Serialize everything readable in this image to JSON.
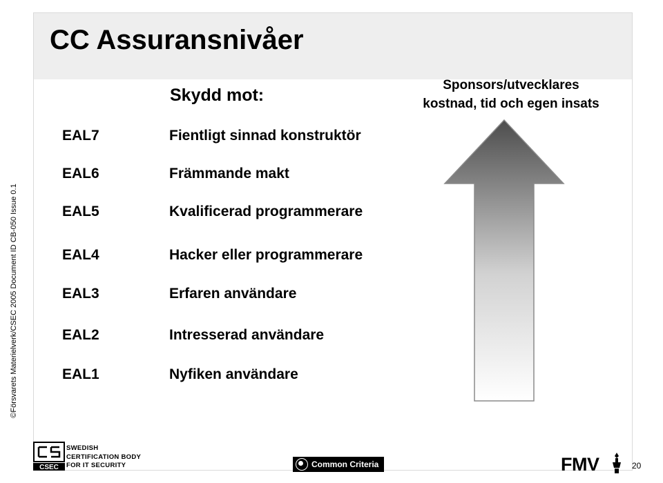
{
  "slide": {
    "title": "CC Assuransnivåer",
    "page_number": "20"
  },
  "headers": {
    "protection": "Skydd mot:",
    "sponsor_line1": "Sponsors/utvecklares",
    "sponsor_line2": "kostnad, tid och egen insats"
  },
  "levels": [
    {
      "eal": "EAL7",
      "threat": "Fientligt sinnad konstruktör"
    },
    {
      "eal": "EAL6",
      "threat": "Främmande makt"
    },
    {
      "eal": "EAL5",
      "threat": "Kvalificerad programmerare"
    },
    {
      "eal": "EAL4",
      "threat": "Hacker eller programmerare"
    },
    {
      "eal": "EAL3",
      "threat": "Erfaren användare"
    },
    {
      "eal": "EAL2",
      "threat": "Intresserad användare"
    },
    {
      "eal": "EAL1",
      "threat": "Nyfiken användare"
    }
  ],
  "sidebar": {
    "vertical_text": "©Försvarets Materielverk/CSEC 2005 Document ID CB-050  Issue 0.1"
  },
  "footer": {
    "csec_logo_text": "CSEC",
    "org_line1": "SWEDISH",
    "org_line2": "CERTIFICATION BODY",
    "org_line3": "FOR IT SECURITY",
    "common_criteria_label": "Common Criteria",
    "fmv_logo_text": "FMV"
  },
  "colors": {
    "title_band": "#eeeeee",
    "text": "#000000",
    "arrow_light": "#ffffff",
    "arrow_dark": "#4d4d4d",
    "frame_border": "#d9d9d9"
  }
}
